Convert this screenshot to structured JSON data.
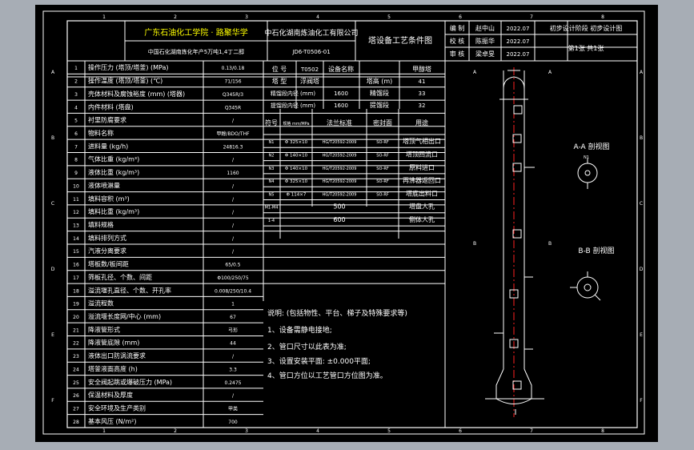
{
  "title_block": {
    "school": "广东石油化工学院 · 路聚华学",
    "company": "中石化湖南炼油化工有限公司",
    "project": "中国石化湖南炼化年产5万吨1,4丁二醇",
    "drawing_no": "JD6-T0506-01",
    "sheet_title": "塔设备工艺条件图",
    "roles": [
      "编 制",
      "校 核",
      "审 核"
    ],
    "names": [
      "赵中山",
      "陈振华",
      "梁卓旻"
    ],
    "dates": [
      "2022.07",
      "2022.07",
      "2022.07"
    ],
    "stage": "初步设计阶段 初步设计图",
    "page": "第1张  共1张"
  },
  "params": [
    {
      "no": "1",
      "name": "操作压力 (塔顶/塔釜) (MPa)",
      "value": "0.13/0.18"
    },
    {
      "no": "2",
      "name": "操作温度 (塔顶/塔釜) (℃)",
      "value": "71/156"
    },
    {
      "no": "3",
      "name": "壳体材料及腐蚀裕度 (mm) (塔器)",
      "value": "Q345R/3"
    },
    {
      "no": "4",
      "name": "内件材料 (塔盘)",
      "value": "Q345R"
    },
    {
      "no": "5",
      "name": "衬里防腐要求",
      "value": "/"
    },
    {
      "no": "6",
      "name": "物料名称",
      "value": "甲醇/BDO/THF"
    },
    {
      "no": "7",
      "name": "进料量 (kg/h)",
      "value": "24816.3"
    },
    {
      "no": "8",
      "name": "气体比重 (kg/m³)",
      "value": "/"
    },
    {
      "no": "9",
      "name": "液体比重 (kg/m³)",
      "value": "1160"
    },
    {
      "no": "10",
      "name": "液体喷淋量",
      "value": "/"
    },
    {
      "no": "11",
      "name": "填料容积 (m³)",
      "value": "/"
    },
    {
      "no": "12",
      "name": "填料比重 (kg/m³)",
      "value": "/"
    },
    {
      "no": "13",
      "name": "填料规格",
      "value": "/"
    },
    {
      "no": "14",
      "name": "填料排列方式",
      "value": "/"
    },
    {
      "no": "15",
      "name": "汽液分离要求",
      "value": "/"
    },
    {
      "no": "16",
      "name": "塔板数/板间距",
      "value": "65/0.5"
    },
    {
      "no": "17",
      "name": "筛板孔径、个数、间距",
      "value": "Φ100/250/75"
    },
    {
      "no": "18",
      "name": "溢流堰孔直径、个数、开孔率",
      "value": "0.008/250/10.4"
    },
    {
      "no": "19",
      "name": "溢流程数",
      "value": "1"
    },
    {
      "no": "20",
      "name": "溢流堰长度网/中心 (mm)",
      "value": "67"
    },
    {
      "no": "21",
      "name": "降液管形式",
      "value": "弓形"
    },
    {
      "no": "22",
      "name": "降液管底隙 (mm)",
      "value": "44"
    },
    {
      "no": "23",
      "name": "液体出口防涡流要求",
      "value": "/"
    },
    {
      "no": "24",
      "name": "塔釜液面高度 (h)",
      "value": "3.3"
    },
    {
      "no": "25",
      "name": "安全阀起跳或爆破压力 (MPa)",
      "value": "0.2475"
    },
    {
      "no": "26",
      "name": "保温材料及厚度",
      "value": "/"
    },
    {
      "no": "27",
      "name": "安全环境及生产类别",
      "value": "甲类"
    },
    {
      "no": "28",
      "name": "基本风压 (N/m²)",
      "value": "700"
    }
  ],
  "equipment": {
    "pos_label": "位 号",
    "pos_value": "T0502",
    "name_label": "设备名称",
    "name_value": "甲醇塔",
    "type_label": "塔 型",
    "type_value": "浮阀塔",
    "height_label": "塔高 (m)",
    "height_value": "41",
    "diam_label": "精馏段内径 (mm)",
    "diam_value": "1600",
    "sect1_label": "精馏段",
    "sect1_value": "33",
    "strip_label": "提馏段内径 (mm)",
    "strip_value": "1600",
    "sect2_label": "提馏段",
    "sect2_value": "32"
  },
  "nozzles": {
    "headers": [
      "符号",
      "规格 mm/MPa",
      "法兰标准",
      "密封面",
      "用途"
    ],
    "rows": [
      {
        "sym": "N1",
        "spec": "Φ 325×10",
        "std": "HG/T20592-2009",
        "face": "SO-RF",
        "use": "塔顶气相出口"
      },
      {
        "sym": "N2",
        "spec": "Φ 140×10",
        "std": "HG/T20592-2009",
        "face": "SO-RF",
        "use": "塔顶回流口"
      },
      {
        "sym": "N3",
        "spec": "Φ 140×10",
        "std": "HG/T20592-2009",
        "face": "SO-RF",
        "use": "原料进口"
      },
      {
        "sym": "N4",
        "spec": "Φ 325×10",
        "std": "HG/T20592-2009",
        "face": "SO-RF",
        "use": "再沸器返回口"
      },
      {
        "sym": "N5",
        "spec": "Φ 114×7",
        "std": "HG/T20592-2009",
        "face": "SO-RF",
        "use": "塔底出料口"
      },
      {
        "sym": "M1-M4",
        "spec": "500",
        "std": "",
        "face": "",
        "use": "塔盘人孔"
      },
      {
        "sym": "1-4",
        "spec": "600",
        "std": "",
        "face": "",
        "use": "侧体人孔"
      }
    ]
  },
  "notes": {
    "title": "说明: (包括物性、平台、梯子及特殊要求等)",
    "items": [
      "1、设备需静电接地;",
      "2、管口尺寸以此表为准;",
      "3、设置安装平面: ±0.000平面;",
      "4、管口方位以工艺管口方位图为准。"
    ]
  },
  "views": {
    "aa": "A-A 剖视图",
    "bb": "B-B 剖视图",
    "mark_a": "A",
    "mark_b": "B",
    "mark_n": "N1"
  },
  "margin": {
    "rows": [
      "A",
      "B",
      "C",
      "D",
      "E",
      "F"
    ],
    "cols": [
      "1",
      "2",
      "3",
      "4",
      "5",
      "6",
      "7",
      "8"
    ]
  },
  "colors": {
    "background": "#000000",
    "line": "#ffffff",
    "text": "#ffff00",
    "center_line": "#ff2020",
    "app_bg": "#a7adb5"
  }
}
